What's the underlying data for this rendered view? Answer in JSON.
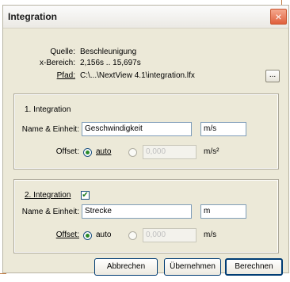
{
  "window": {
    "title": "Integration",
    "close_glyph": "×"
  },
  "info": {
    "quelle_label": "Quelle:",
    "quelle_value": "Beschleunigung",
    "xbereich_label": "x-Bereich:",
    "xbereich_value": "2,156s .. 15,697s",
    "pfad_label": "Pfad:",
    "pfad_value": "C:\\...\\NextView 4.1\\integration.lfx",
    "browse_label": "..."
  },
  "integration1": {
    "heading": "1. Integration",
    "name_label": "Name & Einheit:",
    "name_value": "Geschwindigkeit",
    "unit_value": "m/s",
    "offset_label": "Offset:",
    "auto_label": "auto",
    "offset_value": "0,000",
    "offset_unit": "m/s²"
  },
  "integration2": {
    "heading": "2. Integration",
    "enabled_mark": "✔",
    "name_label": "Name & Einheit:",
    "name_value": "Strecke",
    "unit_value": "m",
    "offset_label": "Offset:",
    "auto_label": "auto",
    "offset_value": "0,000",
    "offset_unit": "m/s"
  },
  "buttons": {
    "cancel": "Abbrechen",
    "apply": "Übernehmen",
    "compute": "Berechnen"
  }
}
